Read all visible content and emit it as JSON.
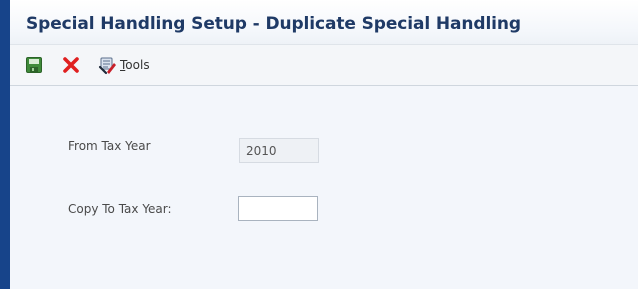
{
  "window": {
    "title": "Special Handling Setup - Duplicate Special Handling"
  },
  "toolbar": {
    "save_icon": "save-icon",
    "cancel_icon": "cancel-icon",
    "tools_icon": "tools-icon",
    "tools_label": "Tools"
  },
  "form": {
    "from_tax_year_label": "From Tax Year",
    "from_tax_year_value": "2010",
    "copy_to_tax_year_label": "Copy To Tax Year:",
    "copy_to_tax_year_value": ""
  },
  "colors": {
    "title_text": "#1f3a66",
    "left_border": "#17448a",
    "cancel_red": "#e02020",
    "save_green": "#3f8a3a"
  }
}
